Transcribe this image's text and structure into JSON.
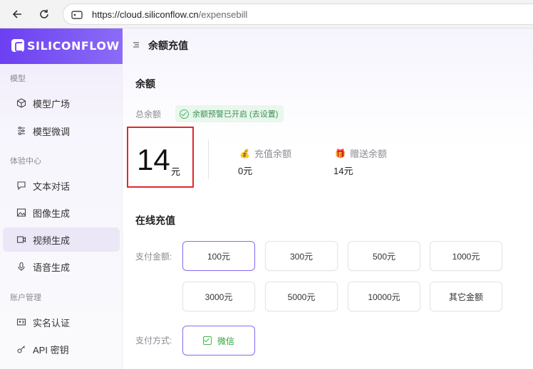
{
  "browser": {
    "back_icon": "arrow-left",
    "reload_icon": "reload",
    "url_icon": "site-info",
    "url_main": "https://cloud.siliconflow.cn",
    "url_path": "/expensebill"
  },
  "sidebar": {
    "logo_text": "SILICONFLOW",
    "sections": {
      "models": "模型",
      "experience": "体验中心",
      "account": "账户管理"
    },
    "items": [
      {
        "label": "模型广场",
        "icon": "cube-icon"
      },
      {
        "label": "模型微调",
        "icon": "tune-icon"
      },
      {
        "label": "文本对话",
        "icon": "chat-icon"
      },
      {
        "label": "图像生成",
        "icon": "image-icon"
      },
      {
        "label": "视频生成",
        "icon": "video-icon",
        "active": true
      },
      {
        "label": "语音生成",
        "icon": "mic-icon"
      },
      {
        "label": "实名认证",
        "icon": "id-card-icon"
      },
      {
        "label": "API 密钥",
        "icon": "key-icon"
      }
    ]
  },
  "main": {
    "page_title": "余额充值",
    "balance_section": "余额",
    "total_balance_label": "总余额",
    "alert_tag": "余额预警已开启 (去设置)",
    "total_value": "14",
    "total_unit": "元",
    "recharge_label": "充值余额",
    "recharge_value": "0元",
    "gift_label": "赠送余额",
    "gift_value": "14元",
    "online_section": "在线充值",
    "amount_label": "支付金额:",
    "amounts": [
      "100元",
      "300元",
      "500元",
      "1000元",
      "3000元",
      "5000元",
      "10000元",
      "其它金额"
    ],
    "selected_amount": "100元",
    "method_label": "支付方式:",
    "method_wechat": "微信"
  },
  "colors": {
    "accent": "#7c4dff",
    "highlight_box": "#e0282a",
    "success": "#3dbb4a"
  }
}
